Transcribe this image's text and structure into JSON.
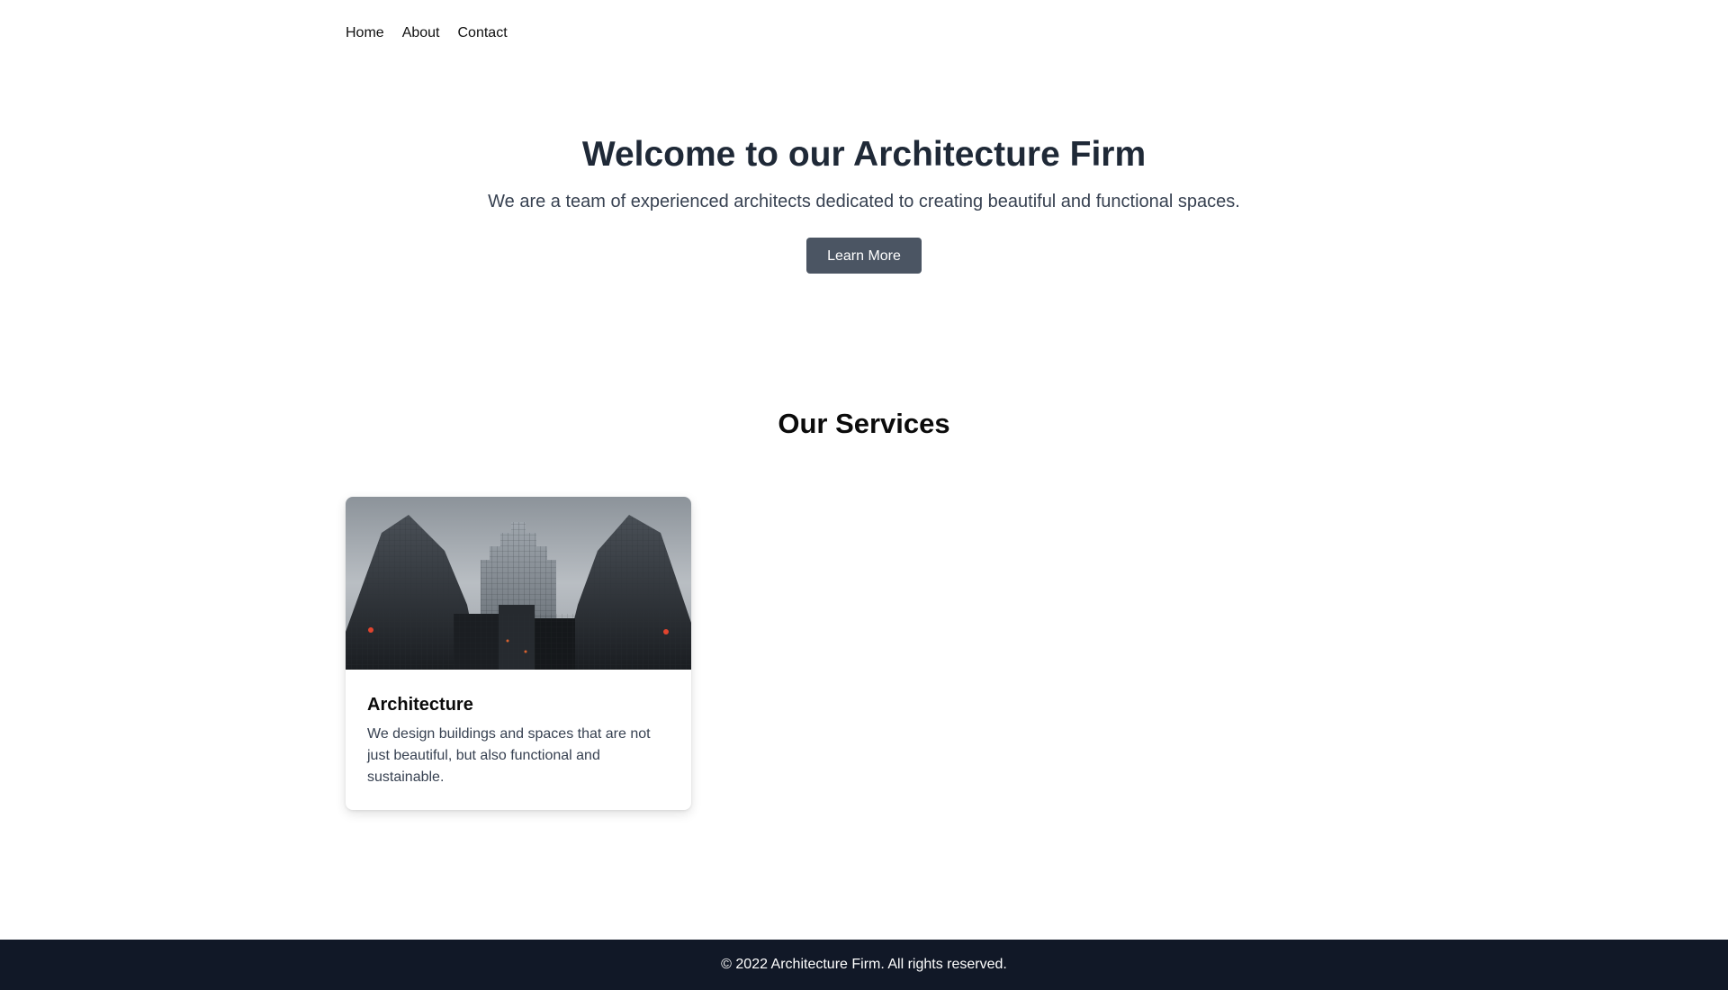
{
  "nav": {
    "items": [
      {
        "label": "Home"
      },
      {
        "label": "About"
      },
      {
        "label": "Contact"
      }
    ]
  },
  "hero": {
    "title": "Welcome to our Architecture Firm",
    "subtitle": "We are a team of experienced architects dedicated to creating beautiful and functional spaces.",
    "button_label": "Learn More"
  },
  "services": {
    "title": "Our Services",
    "cards": [
      {
        "image": "skyscrapers-photo",
        "title": "Architecture",
        "description": "We design buildings and spaces that are not just beautiful, but also functional and sustainable."
      }
    ]
  },
  "footer": {
    "text": "© 2022 Architecture Firm. All rights reserved."
  },
  "colors": {
    "button": "#4b5563",
    "footer_bg": "#111827",
    "heading": "#1f2937"
  }
}
